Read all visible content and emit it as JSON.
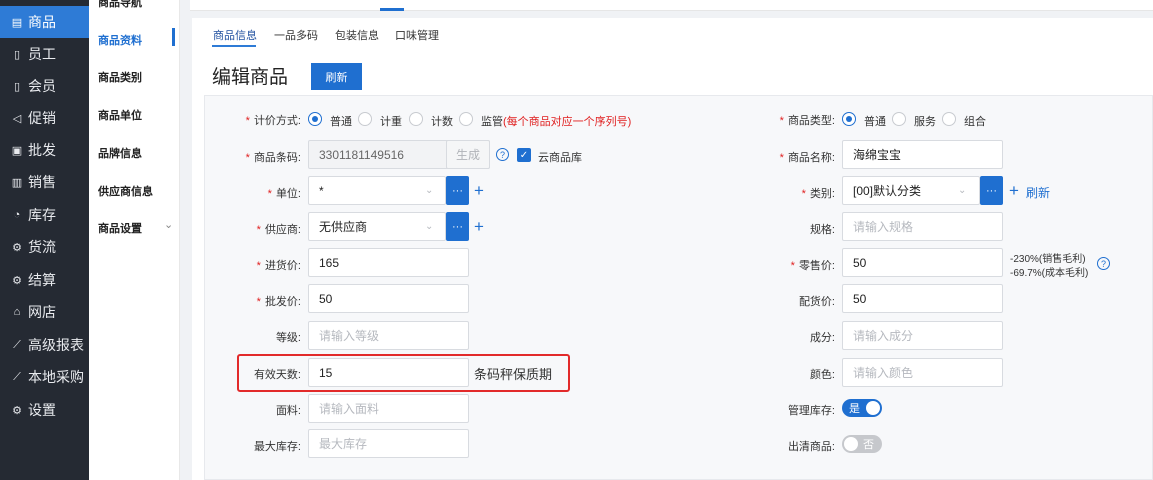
{
  "sidebar": {
    "items": [
      {
        "label": "商品",
        "icon": "goods-icon",
        "glyph": "▤"
      },
      {
        "label": "员工",
        "icon": "staff-icon",
        "glyph": "▯"
      },
      {
        "label": "会员",
        "icon": "member-icon",
        "glyph": "▯"
      },
      {
        "label": "促销",
        "icon": "promo-icon",
        "glyph": "◁"
      },
      {
        "label": "批发",
        "icon": "wholesale-icon",
        "glyph": "▣"
      },
      {
        "label": "销售",
        "icon": "sales-icon",
        "glyph": "▥"
      },
      {
        "label": "库存",
        "icon": "stock-icon",
        "glyph": "◔"
      },
      {
        "label": "货流",
        "icon": "flow-icon",
        "glyph": "⚙"
      },
      {
        "label": "结算",
        "icon": "settle-icon",
        "glyph": "⚙"
      },
      {
        "label": "网店",
        "icon": "shop-icon",
        "glyph": "⌂"
      },
      {
        "label": "高级报表",
        "icon": "report-icon",
        "glyph": "⟋"
      },
      {
        "label": "本地采购",
        "icon": "purchase-icon",
        "glyph": "⟋"
      },
      {
        "label": "设置",
        "icon": "settings-icon",
        "glyph": "⚙"
      }
    ]
  },
  "submenu": {
    "items": [
      "商品导航",
      "商品资料",
      "商品类别",
      "商品单位",
      "品牌信息",
      "供应商信息",
      "商品设置"
    ],
    "expand_glyph": "⌄"
  },
  "tabs": [
    "商品信息",
    "一品多码",
    "包装信息",
    "口味管理"
  ],
  "page": {
    "title": "编辑商品",
    "refresh_label": "刷新"
  },
  "form": {
    "pricing": {
      "label": "计价方式:",
      "options": [
        "普通",
        "计重",
        "计数",
        "监管"
      ],
      "note": "(每个商品对应一个序列号)"
    },
    "product_type": {
      "label": "商品类型:",
      "options": [
        "普通",
        "服务",
        "组合"
      ]
    },
    "barcode": {
      "label": "商品条码:",
      "value": "3301181149516",
      "generate": "生成",
      "cloud": "云商品库"
    },
    "name": {
      "label": "商品名称:",
      "value": "海绵宝宝"
    },
    "unit": {
      "label": "单位:",
      "value": "*",
      "more": "···"
    },
    "category": {
      "label": "类别:",
      "value": "[00]默认分类",
      "more": "···",
      "refresh": "刷新"
    },
    "supplier": {
      "label": "供应商:",
      "value": "无供应商",
      "more": "···"
    },
    "spec": {
      "label": "规格:",
      "placeholder": "请输入规格"
    },
    "cost": {
      "label": "进货价:",
      "value": "165"
    },
    "retail": {
      "label": "零售价:",
      "value": "50",
      "margin1": "-230%(销售毛利)",
      "margin2": "-69.7%(成本毛利)"
    },
    "wholesale": {
      "label": "批发价:",
      "value": "50"
    },
    "dist": {
      "label": "配货价:",
      "value": "50"
    },
    "grade": {
      "label": "等级:",
      "placeholder": "请输入等级"
    },
    "composition": {
      "label": "成分:",
      "placeholder": "请输入成分"
    },
    "shelf": {
      "label": "有效天数:",
      "value": "15",
      "suffix": "条码秤保质期"
    },
    "color": {
      "label": "颜色:",
      "placeholder": "请输入颜色"
    },
    "fabric": {
      "label": "面料:",
      "placeholder": "请输入面料"
    },
    "manage_stock": {
      "label": "管理库存:",
      "state": "是"
    },
    "max_stock": {
      "label": "最大库存:",
      "placeholder": "最大库存"
    },
    "clearance": {
      "label": "出清商品:",
      "state": "否"
    }
  },
  "colors": {
    "accent": "#1f6fd0",
    "sidebar": "#252a33",
    "required": "#e02020",
    "highlight": "#e22a2a"
  }
}
